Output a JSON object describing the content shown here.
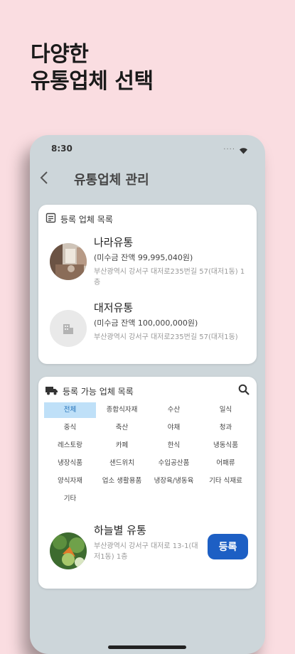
{
  "headline": {
    "line1": "다양한",
    "line2": "유통업체 선택"
  },
  "status_bar": {
    "time": "8:30",
    "signal": "...."
  },
  "app_bar": {
    "back_icon": "chevron-left-icon",
    "title": "유통업체 관리"
  },
  "registered": {
    "header": "등록 업체 목록",
    "icon": "list-icon",
    "items": [
      {
        "name": "나라유통",
        "unpaid": "(미수금 잔액 99,995,040원)",
        "address": "부산광역시 강서구 대저로235번길 57(대저1동) 1층",
        "avatar": "photo-shop-interior"
      },
      {
        "name": "대저유통",
        "unpaid": "(미수금 잔액 100,000,000원)",
        "address": "부산광역시 강서구 대저로235번길 57(대저1동)",
        "avatar": "building-icon"
      }
    ]
  },
  "available": {
    "header": "등록 가능 업체 목록",
    "icon": "truck-icon",
    "search_icon": "search-icon",
    "categories": [
      "전체",
      "종합식자재",
      "수산",
      "일식",
      "중식",
      "축산",
      "야채",
      "청과",
      "레스토랑",
      "카페",
      "한식",
      "냉동식품",
      "냉장식품",
      "샌드위치",
      "수입공산품",
      "어패류",
      "양식자재",
      "업소 생활용품",
      "냉장육/냉동육",
      "기타 식재료",
      "기타"
    ],
    "selected_category": "전체",
    "item": {
      "name": "하늘별 유통",
      "address": "부산광역시 강서구 대저로 13-1(대저1동) 1층",
      "button": "등록"
    }
  },
  "colors": {
    "background": "#fadde1",
    "accent": "#1d5fc4",
    "selected_chip": "#bfe0f8"
  }
}
